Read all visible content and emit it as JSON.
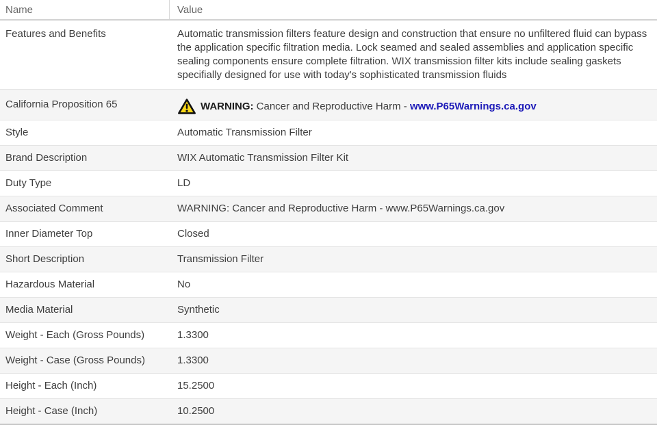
{
  "table": {
    "columns": [
      {
        "label": "Name"
      },
      {
        "label": "Value"
      }
    ],
    "rows": [
      {
        "name": "Features and Benefits",
        "value": "Automatic transmission filters feature design and construction that ensure no unfiltered fluid can bypass the application specific filtration media. Lock seamed and sealed assemblies and application specific sealing components ensure complete filtration. WIX transmission filter kits include sealing gaskets specifially designed for use with today's sophisticated transmission fluids",
        "kind": "tall"
      },
      {
        "name": "California Proposition 65",
        "kind": "warning",
        "warning": {
          "icon": "warning-triangle-icon",
          "label": "WARNING:",
          "text": "Cancer and Reproductive Harm - ",
          "link": "www.P65Warnings.ca.gov"
        }
      },
      {
        "name": "Style",
        "value": "Automatic Transmission Filter"
      },
      {
        "name": "Brand Description",
        "value": "WIX Automatic Transmission Filter Kit"
      },
      {
        "name": "Duty Type",
        "value": "LD"
      },
      {
        "name": "Associated Comment",
        "value": "WARNING: Cancer and Reproductive Harm - www.P65Warnings.ca.gov"
      },
      {
        "name": "Inner Diameter Top",
        "value": "Closed"
      },
      {
        "name": "Short Description",
        "value": "Transmission Filter"
      },
      {
        "name": "Hazardous Material",
        "value": "No"
      },
      {
        "name": "Media Material",
        "value": "Synthetic"
      },
      {
        "name": "Weight - Each (Gross Pounds)",
        "value": "1.3300"
      },
      {
        "name": "Weight - Case (Gross Pounds)",
        "value": "1.3300"
      },
      {
        "name": "Height - Each (Inch)",
        "value": "15.2500"
      },
      {
        "name": "Height - Case (Inch)",
        "value": "10.2500"
      }
    ]
  },
  "colors": {
    "link_blue": "#1c1ab8",
    "warning_yellow": "#f9d616",
    "warning_outline": "#111111",
    "row_stripe": "#f5f5f5",
    "border_gray": "#e4e4e4",
    "header_text": "#666666",
    "body_text": "#3e3e3e"
  }
}
